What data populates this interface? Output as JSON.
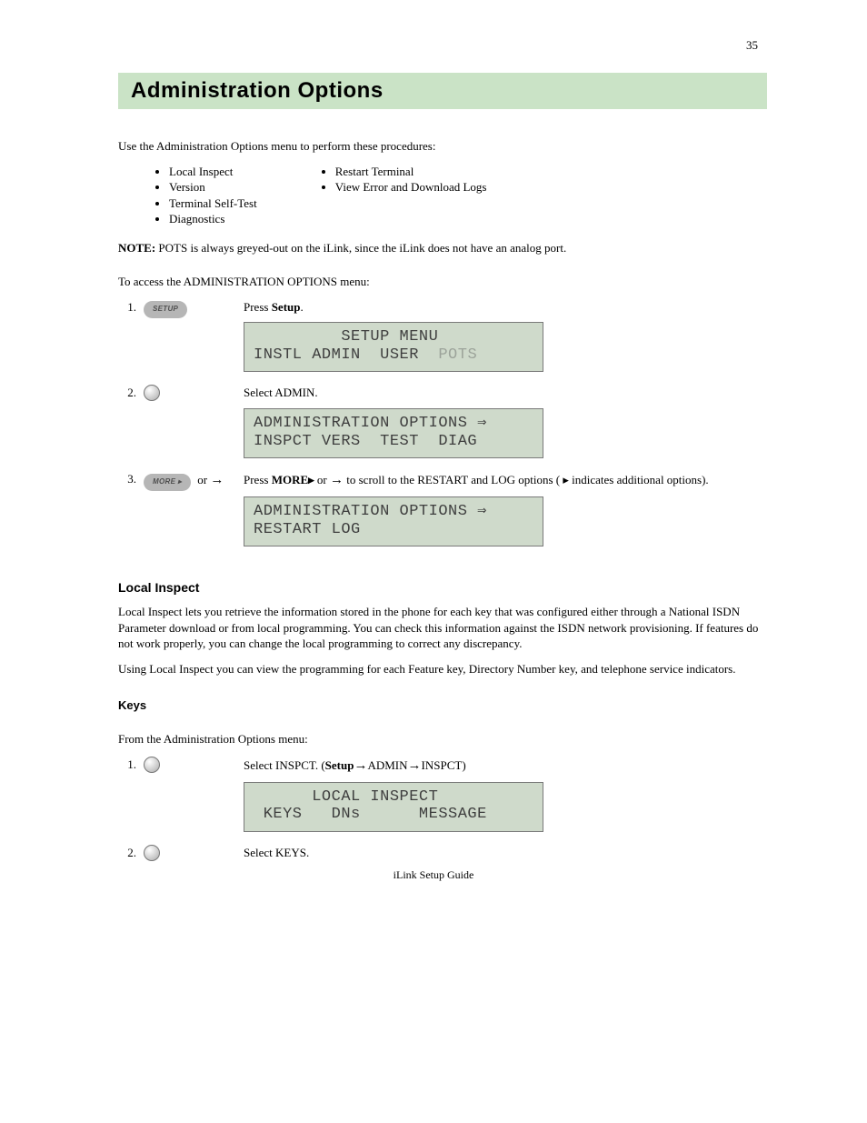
{
  "page_number_top": "35",
  "title": "Administration Options",
  "intro": "Use the Administration Options menu to perform these procedures:",
  "bullets_left": [
    "Local Inspect",
    "Version",
    "Terminal Self-Test",
    "Diagnostics"
  ],
  "bullets_right": [
    "Restart Terminal",
    "View Error and Download Logs",
    "",
    ""
  ],
  "note_text": "POTS is always greyed-out on the iLink, since the iLink does not have an analog port.",
  "note_label": "NOTE:",
  "access_lead": "To access the ADMINISTRATION OPTIONS menu:",
  "steps_access": [
    {
      "n": "1.",
      "action": "setup-btn",
      "desc_prefix": "Press ",
      "desc_suffix": "."
    },
    {
      "n": "2.",
      "action": "softkey",
      "desc": "Select ADMIN."
    },
    {
      "n": "3.",
      "action": "more-btn",
      "desc_pre": "Press ",
      "desc_mid": " or ",
      "arrow1": "→",
      "desc_post": " to scroll to the RESTART and LOG options ( ",
      "arrow2": "▸",
      "desc_tail": " indicates additional options)."
    }
  ],
  "lcd_setup_l1": "         SETUP MENU",
  "lcd_setup_l2a": "INSTL ADMIN  USER  ",
  "lcd_setup_l2b": "POTS",
  "lcd_admin1_l1": "ADMINISTRATION OPTIONS ⇒",
  "lcd_admin1_l2": "INSPCT VERS  TEST  DIAG",
  "lcd_admin2_l1": "ADMINISTRATION OPTIONS ⇒",
  "lcd_admin2_l2": "RESTART LOG",
  "local_inspect_head": "Local Inspect",
  "local_inspect_p1": "Local Inspect lets you retrieve the information stored in the phone for each key that was configured either through a National ISDN Parameter download or from local programming. You can check this information against the ISDN network provisioning. If features do not work properly, you can change the local programming to correct any discrepancy.",
  "local_inspect_p2": "Using Local Inspect you can view the programming for each Feature key, Directory Number key, and telephone service indicators.",
  "keys_head": "Keys",
  "keys_lead": "From the Administration Options menu:",
  "steps_keys": [
    {
      "n": "1.",
      "action": "softkey",
      "desc_a": "Select INSPCT. (",
      "arrow_a": "→",
      "desc_b": "ADMIN",
      "arrow_b": "→",
      "desc_c": "INSPCT)"
    },
    {
      "n": "2.",
      "action": "softkey",
      "desc": "Select KEYS."
    }
  ],
  "lcd_local_l1": "      LOCAL INSPECT",
  "lcd_local_l2": " KEYS   DNs      MESSAGE",
  "footer": "iLink Setup Guide",
  "btn_setup": "SETUP",
  "btn_more": "MORE ▸"
}
